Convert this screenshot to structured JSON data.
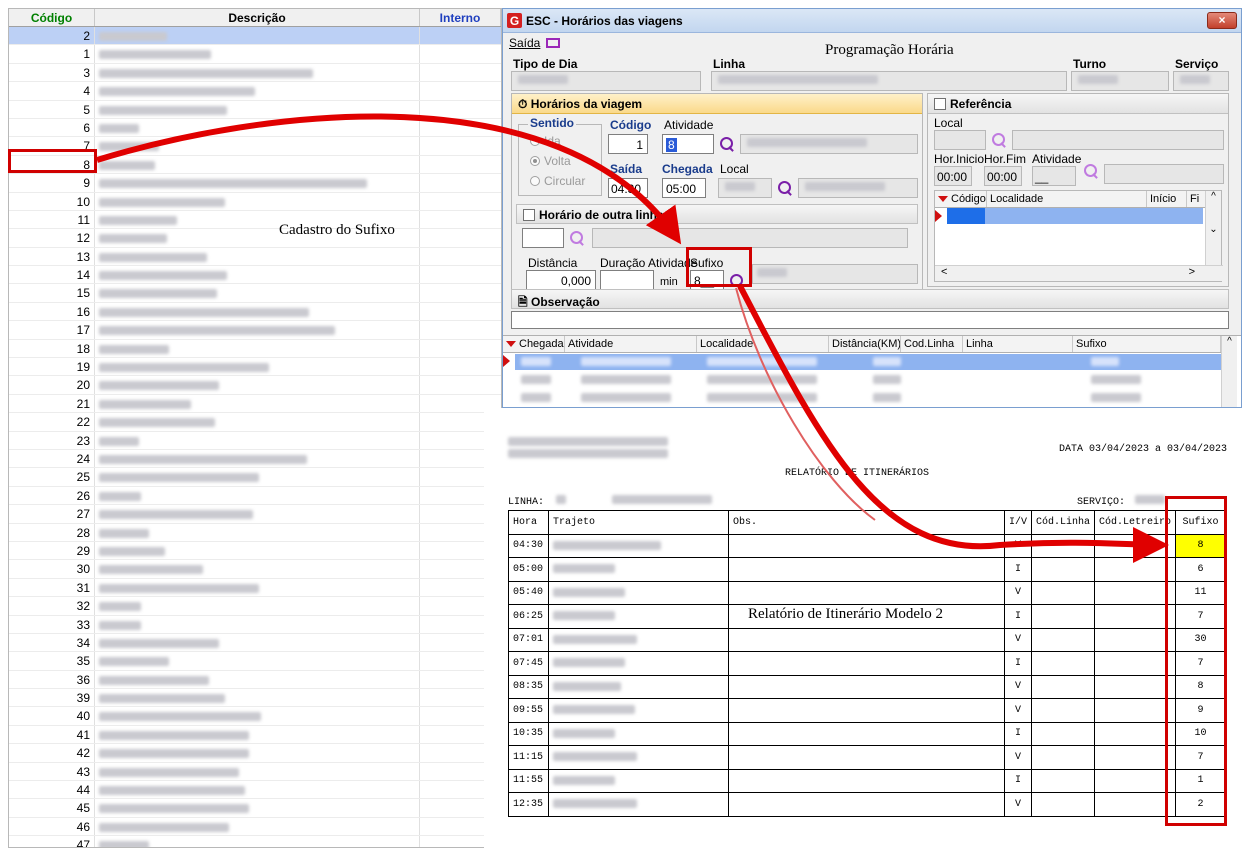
{
  "left_grid": {
    "headers": {
      "codigo": "Código",
      "descricao": "Descrição",
      "interno": "Interno"
    },
    "selected_codigo": "2",
    "rows": [
      "2",
      "1",
      "3",
      "4",
      "5",
      "6",
      "7",
      "8",
      "9",
      "10",
      "11",
      "12",
      "13",
      "14",
      "15",
      "16",
      "17",
      "18",
      "19",
      "20",
      "21",
      "22",
      "23",
      "24",
      "25",
      "26",
      "27",
      "28",
      "29",
      "30",
      "31",
      "32",
      "33",
      "34",
      "35",
      "36",
      "39",
      "40",
      "41",
      "42",
      "43",
      "44",
      "45",
      "46",
      "47"
    ]
  },
  "window": {
    "title": "ESC - Horários das viagens",
    "close_label": "×",
    "menu_saida": "Saída",
    "heading": "Programação Horária",
    "labels": {
      "tipo_de_dia": "Tipo de Dia",
      "linha": "Linha",
      "turno": "Turno",
      "servico": "Serviço"
    },
    "horarios_panel": {
      "title": "Horários da viagem",
      "sentido": "Sentido",
      "radio_ida": "Ida",
      "radio_volta": "Volta",
      "radio_circular": "Circular",
      "codigo_label": "Código",
      "codigo_value": "1",
      "atividade_label": "Atividade",
      "atividade_value": "8",
      "saida_label": "Saída",
      "saida_value": "04:30",
      "chegada_label": "Chegada",
      "chegada_value": "05:00",
      "local_label": "Local",
      "outra_linha": "Horário de outra linha",
      "distancia_label": "Distância",
      "distancia_value": "0,000",
      "duracao_label": "Duração Atividade",
      "duracao_unit": "min",
      "sufixo_label": "Sufixo",
      "sufixo_value": "8__"
    },
    "referencia_panel": {
      "title": "Referência",
      "local": "Local",
      "hor_inicio": "Hor.Inicio",
      "hor_fim": "Hor.Fim",
      "atividade": "Atividade",
      "hor_inicio_value": "00:00",
      "hor_fim_value": "00:00",
      "atividade_value": "__",
      "grid_headers": [
        "Código",
        "Localidade",
        "Início",
        "Fi"
      ]
    },
    "observacao": "Observação",
    "bottom_grid_headers": [
      "Chegada",
      "Atividade",
      "Localidade",
      "Distância(KM)",
      "Cod.Linha",
      "Linha",
      "Sufixo"
    ]
  },
  "report": {
    "date_range": "DATA 03/04/2023 a 03/04/2023",
    "title": "RELATÓRIO DE ITINERÁRIOS",
    "linha_label": "LINHA:",
    "servico_label": "SERVIÇO:",
    "headers": [
      "Hora",
      "Trajeto",
      "Obs.",
      "I/V",
      "Cód.Linha",
      "Cód.Letreiro",
      "Sufixo"
    ],
    "rows": [
      {
        "hora": "04:30",
        "iv": "V",
        "sufixo": "8"
      },
      {
        "hora": "05:00",
        "iv": "I",
        "sufixo": "6"
      },
      {
        "hora": "05:40",
        "iv": "V",
        "sufixo": "11"
      },
      {
        "hora": "06:25",
        "iv": "I",
        "sufixo": "7"
      },
      {
        "hora": "07:01",
        "iv": "V",
        "sufixo": "30"
      },
      {
        "hora": "07:45",
        "iv": "I",
        "sufixo": "7"
      },
      {
        "hora": "08:35",
        "iv": "V",
        "sufixo": "8"
      },
      {
        "hora": "09:55",
        "iv": "V",
        "sufixo": "9"
      },
      {
        "hora": "10:35",
        "iv": "I",
        "sufixo": "10"
      },
      {
        "hora": "11:15",
        "iv": "V",
        "sufixo": "7"
      },
      {
        "hora": "11:55",
        "iv": "I",
        "sufixo": "1"
      },
      {
        "hora": "12:35",
        "iv": "V",
        "sufixo": "2"
      }
    ]
  },
  "annotations": {
    "cadastro": "Cadastro do Sufixo",
    "relatorio": "Relatório de Itinerário Modelo 2",
    "arrow_color": "#e00000"
  }
}
